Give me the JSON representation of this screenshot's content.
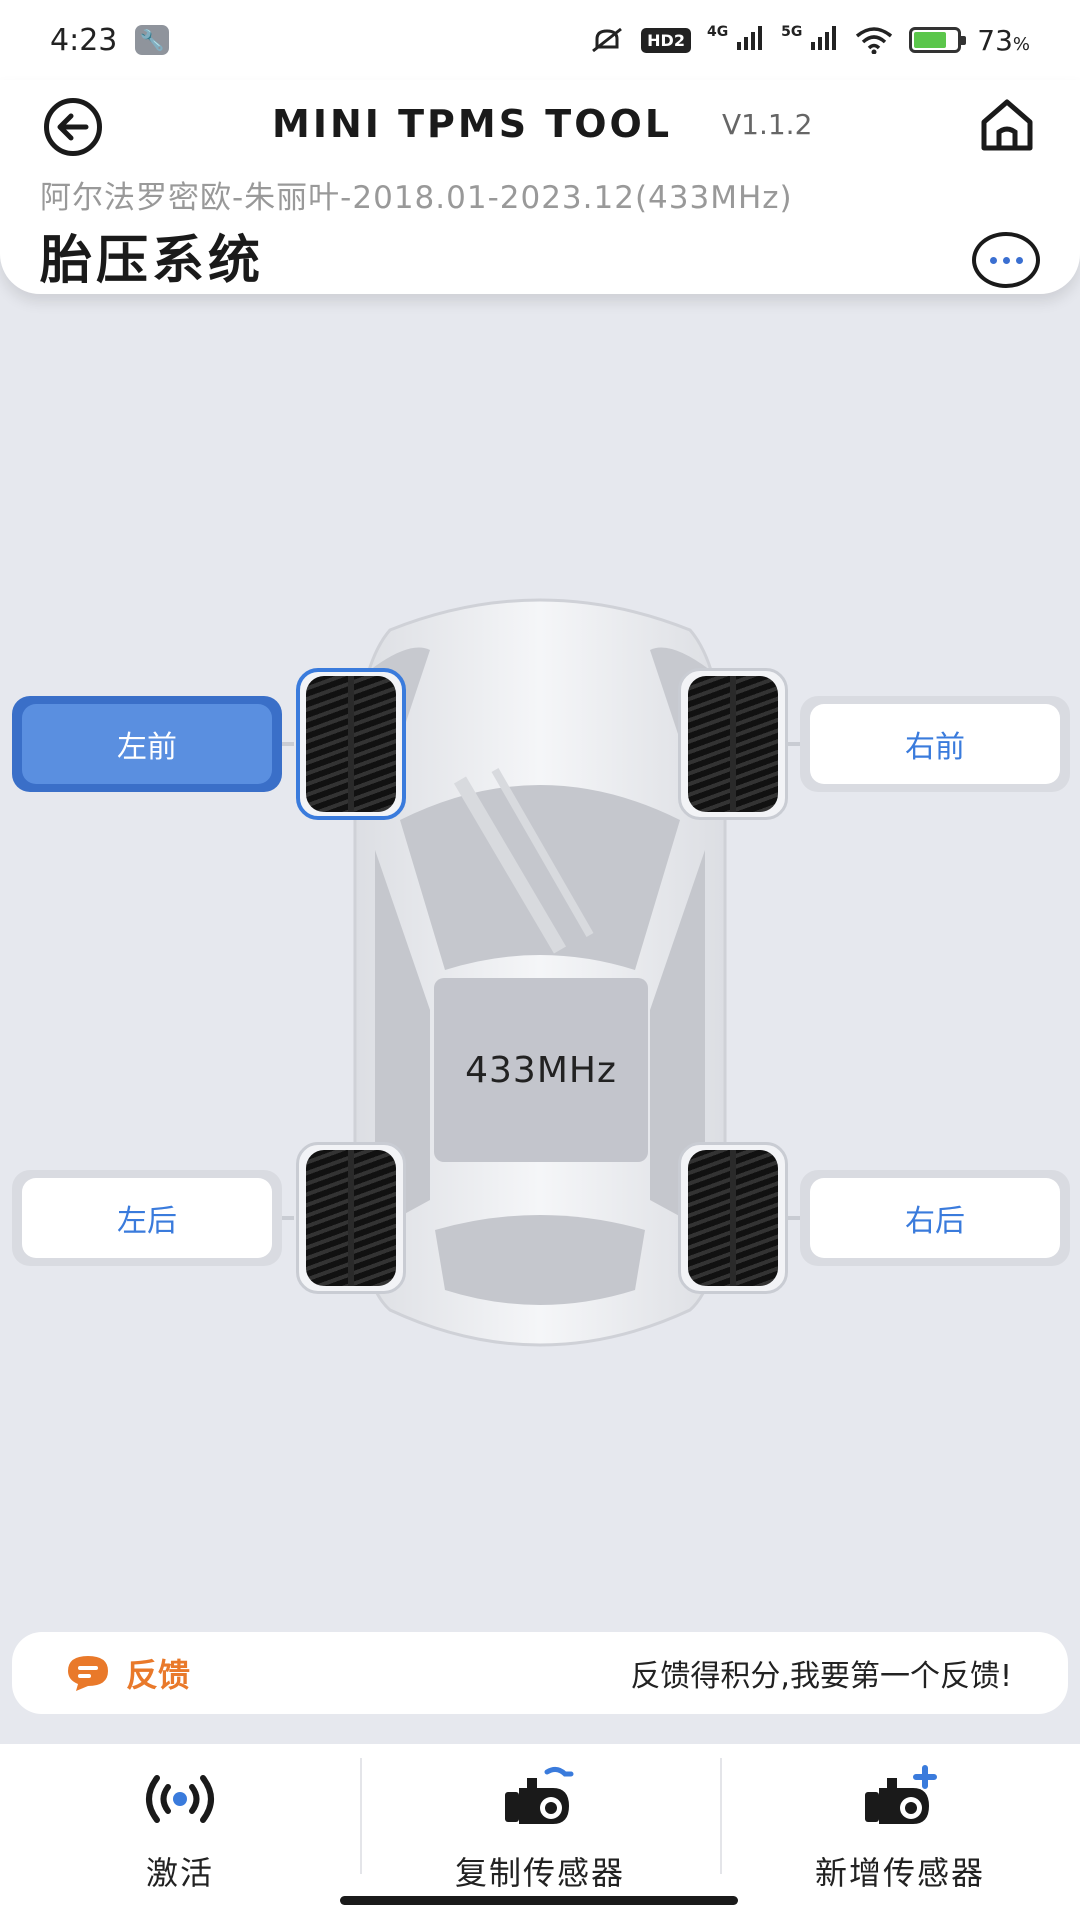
{
  "status_bar": {
    "time": "4:23",
    "hd_badge": "HD2",
    "net_4g": "4G",
    "net_5g": "5G",
    "battery_percent": "73",
    "battery_unit": "%"
  },
  "header": {
    "app_title": "MINI TPMS TOOL",
    "version": "V1.1.2",
    "vehicle": "阿尔法罗密欧-朱丽叶-2018.01-2023.12(433MHz)",
    "page_title": "胎压系统"
  },
  "car": {
    "frequency": "433MHz",
    "tires": {
      "front_left": "左前",
      "front_right": "右前",
      "rear_left": "左后",
      "rear_right": "右后"
    },
    "selected": "front_left"
  },
  "feedback": {
    "label": "反馈",
    "prompt": "反馈得积分,我要第一个反馈!"
  },
  "bottom_nav": {
    "items": [
      {
        "label": "激活",
        "icon": "activate-signal-icon"
      },
      {
        "label": "复制传感器",
        "icon": "copy-sensor-icon"
      },
      {
        "label": "新增传感器",
        "icon": "add-sensor-icon"
      }
    ]
  },
  "colors": {
    "accent": "#3a7bdc",
    "feedback": "#e9792a",
    "background": "#e6e8ee"
  }
}
